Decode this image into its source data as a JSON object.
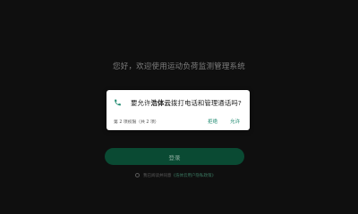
{
  "welcome_text": "您好，欢迎使用运动负荷监测管理系统",
  "login_button_label": "登录",
  "agreement": {
    "prefix": "我已阅读并同意",
    "link": "《浩体云用户隐私政策》"
  },
  "permission_dialog": {
    "title_prefix": "要允许",
    "app_name": "浩体云",
    "title_suffix": "拨打电话和管理通话吗?",
    "counter": "第 2 项权限（共 2 项）",
    "deny_label": "拒绝",
    "allow_label": "允许",
    "icon": "phone-icon"
  },
  "colors": {
    "accent": "#1f8a70",
    "login_button_bg": "#0a4a33",
    "background": "#0f0f0f"
  }
}
